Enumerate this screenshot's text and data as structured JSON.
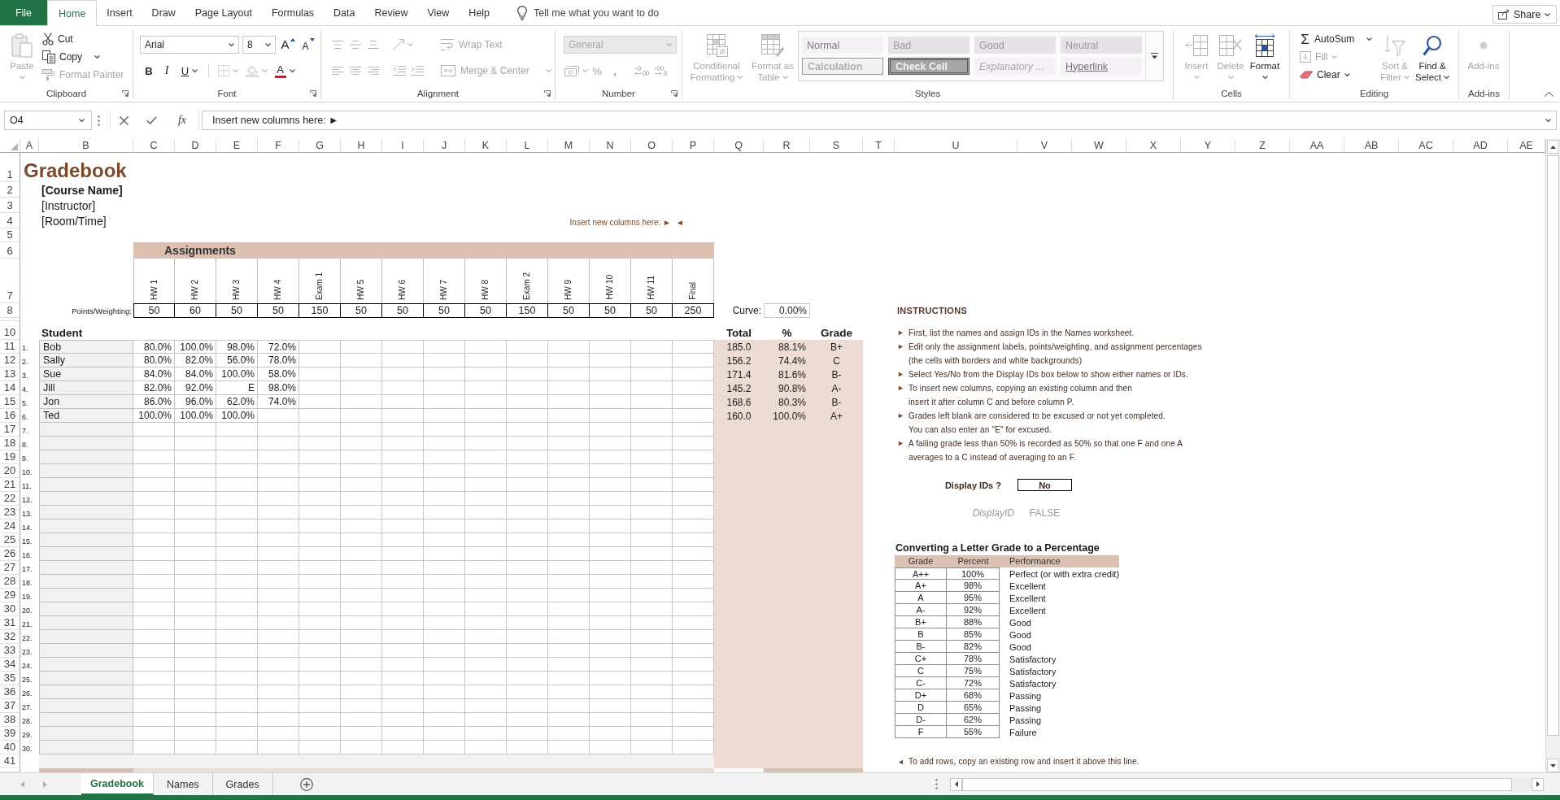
{
  "ribbon_tabs": [
    {
      "label": "File",
      "kind": "file",
      "selected": false
    },
    {
      "label": "Home",
      "kind": "tab",
      "selected": true
    },
    {
      "label": "Insert",
      "kind": "tab",
      "selected": false
    },
    {
      "label": "Draw",
      "kind": "tab",
      "selected": false
    },
    {
      "label": "Page Layout",
      "kind": "tab",
      "selected": false
    },
    {
      "label": "Formulas",
      "kind": "tab",
      "selected": false
    },
    {
      "label": "Data",
      "kind": "tab",
      "selected": false
    },
    {
      "label": "Review",
      "kind": "tab",
      "selected": false
    },
    {
      "label": "View",
      "kind": "tab",
      "selected": false
    },
    {
      "label": "Help",
      "kind": "tab",
      "selected": false
    }
  ],
  "tell_me": {
    "placeholder": "Tell me what you want to do"
  },
  "share_button": {
    "label": "Share"
  },
  "ribbon_groups": [
    {
      "kind": "clipboard",
      "label": "Clipboard",
      "items": [
        {
          "label": "Paste",
          "disabled": true
        },
        {
          "label": "Cut",
          "disabled": false
        },
        {
          "label": "Copy",
          "disabled": false
        },
        {
          "label": "Format Painter",
          "disabled": true
        }
      ]
    },
    {
      "kind": "font",
      "label": "Font",
      "font_name": "Arial",
      "font_size": "8",
      "items": [
        {
          "label": "A",
          "disabled": false
        },
        {
          "label": "A",
          "disabled": false
        },
        {
          "label": "B",
          "disabled": false
        },
        {
          "label": "I",
          "disabled": false
        },
        {
          "label": "U",
          "disabled": false
        },
        {
          "disabled": true
        },
        {
          "disabled": true
        },
        {
          "label": "A",
          "disabled": false
        }
      ]
    },
    {
      "kind": "alignment",
      "label": "Alignment",
      "items": [
        {
          "disabled": true
        },
        {
          "disabled": true
        },
        {
          "disabled": true
        },
        {
          "disabled": true
        },
        {
          "label": "Wrap Text",
          "disabled": true
        },
        {
          "disabled": true
        },
        {
          "disabled": true
        },
        {
          "disabled": true
        },
        {
          "disabled": true
        },
        {
          "disabled": true
        },
        {
          "label": "Merge & Center",
          "disabled": true
        }
      ]
    },
    {
      "kind": "number",
      "label": "Number",
      "format": {
        "value": "General",
        "disabled": true
      },
      "items": [
        {
          "disabled": true
        },
        {
          "label": "%",
          "disabled": true
        },
        {
          "label": ",",
          "disabled": true
        },
        {
          "disabled": true
        },
        {
          "disabled": true
        }
      ]
    },
    {
      "kind": "styles",
      "label": "Styles",
      "items": [
        {
          "label_lines": [
            "Conditional",
            "Formatting"
          ],
          "disabled": true
        },
        {
          "label_lines": [
            "Format as",
            "Table"
          ],
          "disabled": true
        }
      ],
      "gallery": [
        {
          "label": "Normal",
          "kind": "normal",
          "disabled": true
        },
        {
          "label": "Bad",
          "kind": "bad",
          "disabled": true
        },
        {
          "label": "Good",
          "kind": "good",
          "disabled": true
        },
        {
          "label": "Neutral",
          "kind": "neutral",
          "disabled": true
        },
        {
          "label": "Calculation",
          "kind": "calculation",
          "disabled": true
        },
        {
          "label": "Check Cell",
          "kind": "check",
          "disabled": true
        },
        {
          "label": "Explanatory ...",
          "kind": "explanatory",
          "disabled": true
        },
        {
          "label": "Hyperlink",
          "kind": "hyperlink",
          "disabled": true
        }
      ]
    },
    {
      "kind": "cells",
      "label": "Cells",
      "items": [
        {
          "label": "Insert",
          "disabled": true
        },
        {
          "label": "Delete",
          "disabled": true
        },
        {
          "label": "Format",
          "disabled": false
        }
      ]
    },
    {
      "kind": "editing",
      "label": "Editing",
      "items": [
        {
          "label": "AutoSum",
          "symbol": "Σ",
          "disabled": false
        },
        {
          "label": "Fill",
          "disabled": true
        },
        {
          "label": "Clear",
          "disabled": false
        },
        {
          "label_lines": [
            "Sort &",
            "Filter"
          ],
          "disabled": true
        },
        {
          "label_lines": [
            "Find &",
            "Select"
          ],
          "disabled": false
        }
      ]
    },
    {
      "kind": "addins",
      "label": "Add-ins",
      "items": [
        {
          "label": "Add-ins",
          "disabled": true
        }
      ]
    }
  ],
  "formula_bar": {
    "name_box": "O4",
    "function_label": "fx",
    "formula": "Insert new columns here: ►"
  },
  "sheet": {
    "column_headers": [
      "A",
      "B",
      "C",
      "D",
      "E",
      "F",
      "G",
      "H",
      "I",
      "J",
      "K",
      "L",
      "M",
      "N",
      "O",
      "P",
      "Q",
      "R",
      "S",
      "T",
      "U",
      "V",
      "W",
      "X",
      "Y",
      "Z",
      "AA",
      "AB",
      "AC",
      "AD",
      "AE"
    ],
    "row_headers": [
      "1",
      "2",
      "3",
      "4",
      "5",
      "6",
      "7",
      "8",
      "10",
      "11",
      "12",
      "13",
      "14",
      "15",
      "16",
      "17",
      "18",
      "19",
      "20",
      "21",
      "22",
      "23",
      "24",
      "25",
      "26",
      "27",
      "28",
      "29",
      "30",
      "31",
      "32",
      "33",
      "34",
      "35",
      "36",
      "37",
      "38",
      "39",
      "40",
      "41"
    ],
    "title": "Gradebook",
    "course_name": "[Course Name]",
    "instructor": "[Instructor]",
    "room_time": "[Room/Time]",
    "insert_note": "Insert new columns here: ►",
    "insert_end": "◄",
    "assignments_title": "Assignments",
    "points_label": "Points/Weighting:",
    "assignments": [
      {
        "label": "HW 1",
        "points": "50"
      },
      {
        "label": "HW 2",
        "points": "60"
      },
      {
        "label": "HW 3",
        "points": "50"
      },
      {
        "label": "HW 4",
        "points": "50"
      },
      {
        "label": "Exam 1",
        "points": "150"
      },
      {
        "label": "HW 5",
        "points": "50"
      },
      {
        "label": "HW 6",
        "points": "50"
      },
      {
        "label": "HW 7",
        "points": "50"
      },
      {
        "label": "HW 8",
        "points": "50"
      },
      {
        "label": "Exam 2",
        "points": "150"
      },
      {
        "label": "HW 9",
        "points": "50"
      },
      {
        "label": "HW 10",
        "points": "50"
      },
      {
        "label": "HW 11",
        "points": "50"
      },
      {
        "label": "Final",
        "points": "250"
      }
    ],
    "curve": {
      "label": "Curve:",
      "value": "0.00%"
    },
    "headers": {
      "student": "Student",
      "total": "Total",
      "percent": "%",
      "grade": "Grade"
    },
    "students": [
      {
        "number": "1.",
        "name": "Bob",
        "scores": [
          "80.0%",
          "100.0%",
          "98.0%",
          "72.0%"
        ],
        "total": "185.0",
        "percent": "88.1%",
        "grade": "B+"
      },
      {
        "number": "2.",
        "name": "Sally",
        "scores": [
          "80.0%",
          "82.0%",
          "56.0%",
          "78.0%"
        ],
        "total": "156.2",
        "percent": "74.4%",
        "grade": "C"
      },
      {
        "number": "3.",
        "name": "Sue",
        "scores": [
          "84.0%",
          "84.0%",
          "100.0%",
          "58.0%"
        ],
        "total": "171.4",
        "percent": "81.6%",
        "grade": "B-"
      },
      {
        "number": "4.",
        "name": "Jill",
        "scores": [
          "82.0%",
          "92.0%",
          "E",
          "98.0%"
        ],
        "total": "145.2",
        "percent": "90.8%",
        "grade": "A-"
      },
      {
        "number": "5.",
        "name": "Jon",
        "scores": [
          "86.0%",
          "96.0%",
          "62.0%",
          "74.0%"
        ],
        "total": "168.6",
        "percent": "80.3%",
        "grade": "B-"
      },
      {
        "number": "6.",
        "name": "Ted",
        "scores": [
          "100.0%",
          "100.0%",
          "100.0%"
        ],
        "total": "160.0",
        "percent": "100.0%",
        "grade": "A+"
      },
      {
        "number": "7."
      },
      {
        "number": "8."
      },
      {
        "number": "9."
      },
      {
        "number": "10."
      },
      {
        "number": "11."
      },
      {
        "number": "12."
      },
      {
        "number": "13."
      },
      {
        "number": "14."
      },
      {
        "number": "15."
      },
      {
        "number": "16."
      },
      {
        "number": "17."
      },
      {
        "number": "18."
      },
      {
        "number": "19."
      },
      {
        "number": "20."
      },
      {
        "number": "21."
      },
      {
        "number": "22."
      },
      {
        "number": "23."
      },
      {
        "number": "24."
      },
      {
        "number": "25."
      },
      {
        "number": "26."
      },
      {
        "number": "27."
      },
      {
        "number": "28."
      },
      {
        "number": "29."
      },
      {
        "number": "30."
      }
    ]
  },
  "instructions": {
    "title": "INSTRUCTIONS",
    "items": [
      {
        "bullet": "►",
        "lines": [
          "First, list the names and assign IDs in the Names worksheet."
        ]
      },
      {
        "bullet": "►",
        "lines": [
          "Edit only the assignment labels, points/weighting, and assignment percentages",
          "(the cells with borders and white backgrounds)"
        ]
      },
      {
        "bullet": "►",
        "lines": [
          "Select Yes/No from the Display IDs box below to show either names or IDs."
        ]
      },
      {
        "bullet": "►",
        "lines": [
          "To insert new columns, copying an existing column and then",
          "insert it after column C and before column P."
        ]
      },
      {
        "bullet": "►",
        "lines": [
          "Grades left blank are considered to be excused or not yet completed.",
          "You can also enter an \"E\" for excused."
        ]
      },
      {
        "bullet": "►",
        "lines": [
          "A failing grade less than 50% is recorded as 50% so that one F and one A",
          "averages to a C instead of averaging to an F."
        ]
      }
    ]
  },
  "display_ids": {
    "label": "Display IDs ?",
    "value": "No"
  },
  "helper_cells": [
    "DisplayID",
    "FALSE"
  ],
  "grade_scale": {
    "title": "Converting a Letter Grade to a Percentage",
    "columns": [
      "Grade",
      "Percent",
      "Performance"
    ],
    "rows": [
      {
        "grade": "A++",
        "percent": "100%",
        "performance": "Perfect (or with extra credit)"
      },
      {
        "grade": "A+",
        "percent": "98%",
        "performance": "Excellent"
      },
      {
        "grade": "A",
        "percent": "95%",
        "performance": "Excellent"
      },
      {
        "grade": "A-",
        "percent": "92%",
        "performance": "Excellent"
      },
      {
        "grade": "B+",
        "percent": "88%",
        "performance": "Good"
      },
      {
        "grade": "B",
        "percent": "85%",
        "performance": "Good"
      },
      {
        "grade": "B-",
        "percent": "82%",
        "performance": "Good"
      },
      {
        "grade": "C+",
        "percent": "78%",
        "performance": "Satisfactory"
      },
      {
        "grade": "C",
        "percent": "75%",
        "performance": "Satisfactory"
      },
      {
        "grade": "C-",
        "percent": "72%",
        "performance": "Satisfactory"
      },
      {
        "grade": "D+",
        "percent": "68%",
        "performance": "Passing"
      },
      {
        "grade": "D",
        "percent": "65%",
        "performance": "Passing"
      },
      {
        "grade": "D-",
        "percent": "62%",
        "performance": "Passing"
      },
      {
        "grade": "F",
        "percent": "55%",
        "performance": "Failure"
      }
    ]
  },
  "add_rows_note": {
    "marker": "◄",
    "text": "To add rows, copy an existing row and insert it above this line."
  },
  "sheet_tabs": [
    {
      "label": "Gradebook",
      "selected": true
    },
    {
      "label": "Names",
      "selected": false
    },
    {
      "label": "Grades",
      "selected": false
    }
  ]
}
